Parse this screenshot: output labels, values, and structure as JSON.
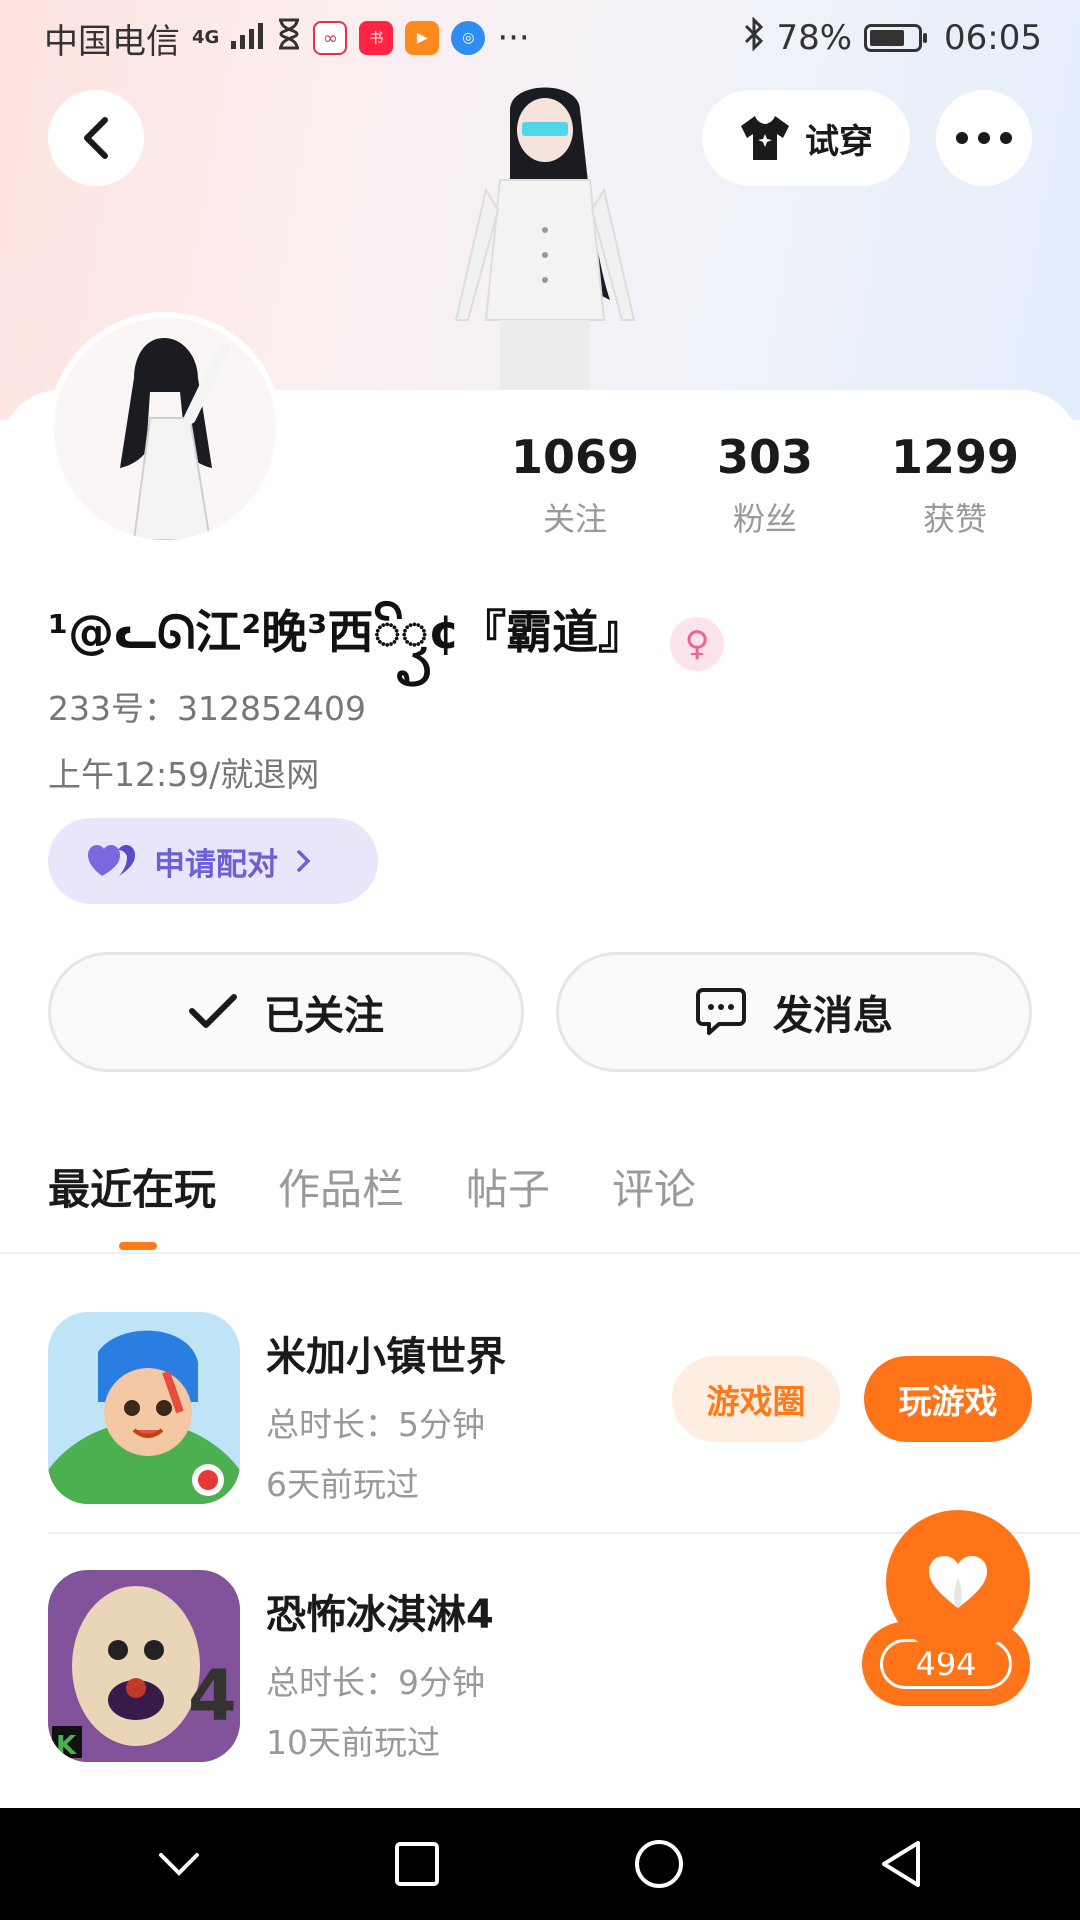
{
  "status_bar": {
    "carrier": "中国电信",
    "network": "4G",
    "battery": "78%",
    "time": "06:05",
    "more": "···"
  },
  "header": {
    "tryon_label": "试穿"
  },
  "stats": [
    {
      "value": "1069",
      "label": "关注"
    },
    {
      "value": "303",
      "label": "粉丝"
    },
    {
      "value": "1299",
      "label": "获赞"
    }
  ],
  "profile": {
    "name": "¹@ᓚᘏ江²晚³西ꦼꦽ¢『霸道』",
    "gender_symbol": "♀",
    "id_line": "233号：312852409",
    "bio": "上午12:59/就退网",
    "pair_label": "申请配对"
  },
  "actions": {
    "follow_label": "已关注",
    "message_label": "发消息"
  },
  "tabs": [
    "最近在玩",
    "作品栏",
    "帖子",
    "评论"
  ],
  "games": [
    {
      "title": "米加小镇世界",
      "duration": "总时长：5分钟",
      "last_played": "6天前玩过",
      "circle_label": "游戏圈",
      "play_label": "玩游戏"
    },
    {
      "title": "恐怖冰淇淋4",
      "duration": "总时长：9分钟",
      "last_played": "10天前玩过"
    }
  ],
  "like_float": {
    "count": "494"
  },
  "colors": {
    "accent": "#ff7418",
    "pair": "#6d5fd6"
  }
}
